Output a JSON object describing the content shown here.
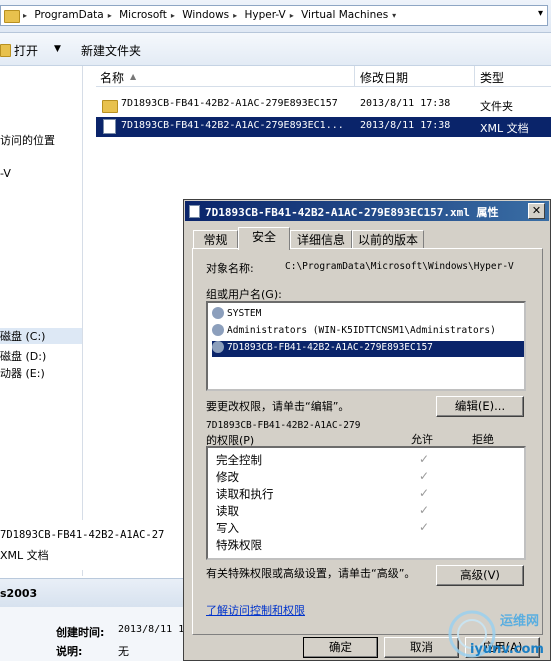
{
  "address": {
    "crumbs": [
      "ProgramData",
      "Microsoft",
      "Windows",
      "Hyper-V",
      "Virtual Machines"
    ]
  },
  "toolbar": {
    "open": "打开",
    "new_folder": "新建文件夹"
  },
  "nav": {
    "items": [
      {
        "label": "访问的位置"
      },
      {
        "label": "-V"
      },
      {
        "label": "磁盘 (C:)"
      },
      {
        "label": "磁盘 (D:)"
      },
      {
        "label": "动器 (E:)"
      }
    ]
  },
  "filelist": {
    "columns": [
      "名称",
      "修改日期",
      "类型"
    ],
    "rows": [
      {
        "name": "7D1893CB-FB41-42B2-A1AC-279E893EC157",
        "date": "2013/8/11 17:38",
        "type": "文件夹"
      },
      {
        "name": "7D1893CB-FB41-42B2-A1AC-279E893EC1...",
        "date": "2013/8/11 17:38",
        "type": "XML 文档"
      }
    ]
  },
  "details": {
    "name": "7D1893CB-FB41-42B2-A1AC-27",
    "type": "XML 文档",
    "section": "s2003",
    "created_label": "创建时间:",
    "created_value": "2013/8/11 1",
    "desc_label": "说明:",
    "desc_value": "无"
  },
  "dialog": {
    "title": "7D1893CB-FB41-42B2-A1AC-279E893EC157.xml 属性",
    "tabs": [
      "常规",
      "安全",
      "详细信息",
      "以前的版本"
    ],
    "object_label": "对象名称:",
    "object_value": "C:\\ProgramData\\Microsoft\\Windows\\Hyper-V",
    "group_label": "组或用户名(G):",
    "users": [
      "SYSTEM",
      "Administrators (WIN-K5IDTTCNSM1\\Administrators)",
      "7D1893CB-FB41-42B2-A1AC-279E893EC157"
    ],
    "change_hint": "要更改权限，请单击“编辑”。",
    "edit_button": "编辑(E)...",
    "perm_for_line1": "7D1893CB-FB41-42B2-A1AC-279",
    "perm_for_line2": "的权限(P)",
    "allow_header": "允许",
    "deny_header": "拒绝",
    "permissions": [
      {
        "name": "完全控制",
        "allow": "✓"
      },
      {
        "name": "修改",
        "allow": "✓"
      },
      {
        "name": "读取和执行",
        "allow": "✓"
      },
      {
        "name": "读取",
        "allow": "✓"
      },
      {
        "name": "写入",
        "allow": "✓"
      },
      {
        "name": "特殊权限",
        "allow": ""
      }
    ],
    "advanced_hint": "有关特殊权限或高级设置，请单击“高级”。",
    "advanced_button": "高级(V)",
    "learn_link": "了解访问控制和权限",
    "ok_button": "确定",
    "cancel_button": "取消",
    "apply_button": "应用(A)"
  },
  "watermark": {
    "line1": "运维网",
    "line2": "iyunv.com"
  }
}
